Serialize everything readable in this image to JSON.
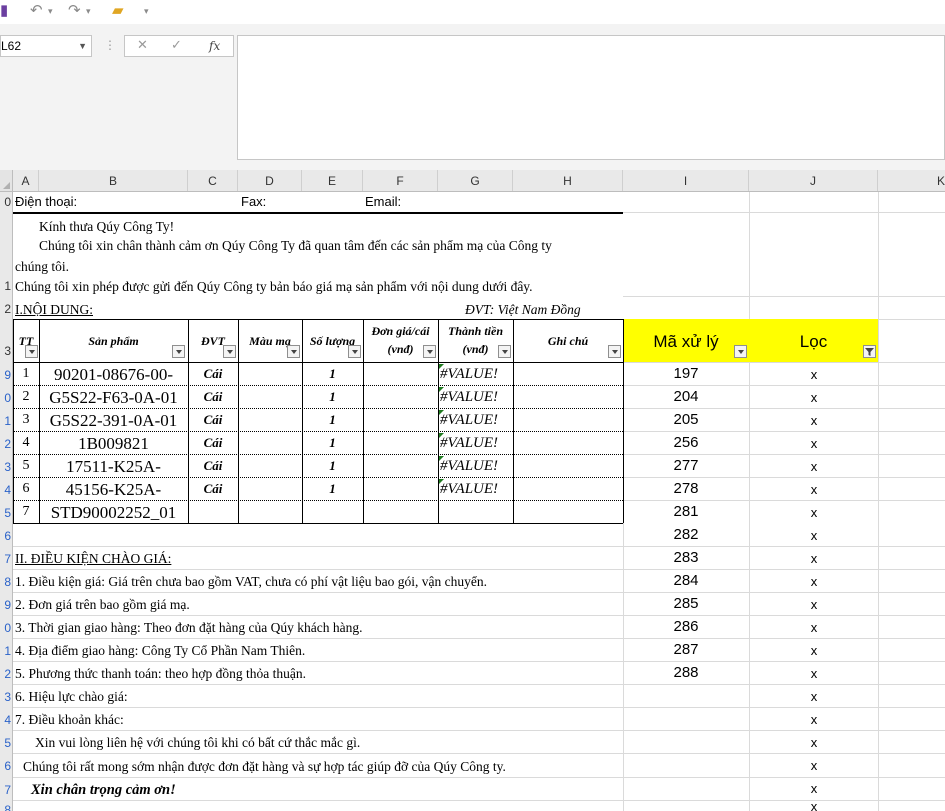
{
  "toolbar": {
    "icons": [
      "save-icon",
      "undo-icon",
      "redo-icon",
      "open-folder-icon"
    ]
  },
  "formula_bar": {
    "name_box": "L62",
    "cancel": "✕",
    "enter": "✓",
    "fx": "fx",
    "content": ""
  },
  "columns": [
    "A",
    "B",
    "C",
    "D",
    "E",
    "F",
    "G",
    "H",
    "I",
    "J",
    "K"
  ],
  "row_numbers": [
    "0",
    "1",
    "2",
    "3",
    "9",
    "0",
    "1",
    "2",
    "3",
    "4",
    "5",
    "6",
    "7",
    "8",
    "9",
    "0",
    "1",
    "2",
    "3",
    "4",
    "5",
    "6",
    "7",
    "8"
  ],
  "header_info": {
    "phone_label": "Điện thoại:",
    "fax_label": "Fax:",
    "email_label": "Email:"
  },
  "greeting": {
    "line1": "Kính thưa Qúy Công Ty!",
    "line2": "Chúng tôi xin chân thành cảm ơn Qúy Công Ty đã quan tâm đến các sản phẩm mạ của Công ty",
    "line3": "chúng tôi.",
    "line4": "Chúng tôi xin phép được gửi đến Qúy Công ty bản báo giá mạ sản phẩm với nội dung dưới đây."
  },
  "section1": {
    "title": "I.NỘI DUNG:",
    "currency": "ĐVT: Việt Nam Đồng"
  },
  "table": {
    "headers": {
      "tt": "TT",
      "product": "Sản phẩm",
      "unit": "ĐVT",
      "finish": "Màu mạ",
      "qty": "Số lượng",
      "price": "Đơn giá/cái",
      "price_unit": "(vnđ)",
      "total": "Thành tiền",
      "total_unit": "(vnđ)",
      "note": "Ghi chú",
      "code": "Mã xử lý",
      "filter": "Lọc"
    },
    "rows": [
      {
        "tt": "1",
        "product": "90201-08676-00-",
        "unit": "Cái",
        "qty": "1",
        "total": "#VALUE!"
      },
      {
        "tt": "2",
        "product": "G5S22-F63-0A-01",
        "unit": "Cái",
        "qty": "1",
        "total": "#VALUE!"
      },
      {
        "tt": "3",
        "product": "G5S22-391-0A-01",
        "unit": "Cái",
        "qty": "1",
        "total": "#VALUE!"
      },
      {
        "tt": "4",
        "product": "1B009821",
        "unit": "Cái",
        "qty": "1",
        "total": "#VALUE!"
      },
      {
        "tt": "5",
        "product": "17511-K25A-",
        "unit": "Cái",
        "qty": "1",
        "total": "#VALUE!"
      },
      {
        "tt": "6",
        "product": "45156-K25A-",
        "unit": "Cái",
        "qty": "1",
        "total": "#VALUE!"
      },
      {
        "tt": "7",
        "product": "STD90002252_01",
        "unit": "",
        "qty": "",
        "total": ""
      }
    ]
  },
  "codes": [
    "197",
    "204",
    "205",
    "256",
    "277",
    "278",
    "281",
    "282",
    "283",
    "284",
    "285",
    "286",
    "287",
    "288"
  ],
  "filter_marks": [
    "x",
    "x",
    "x",
    "x",
    "x",
    "x",
    "x",
    "x",
    "x",
    "x",
    "x",
    "x",
    "x",
    "x",
    "x",
    "x",
    "x",
    "x",
    "x",
    "x"
  ],
  "section2": {
    "title": "II. ĐIỀU KIỆN CHÀO GIÁ:",
    "items": [
      "1. Điều kiện giá: Giá trên chưa bao gồm VAT, chưa có phí vật liệu bao gói, vận chuyển.",
      "2. Đơn giá trên bao gồm giá mạ.",
      "3. Thời gian giao hàng: Theo đơn đặt hàng của Qúy khách hàng.",
      "4. Địa điểm giao hàng: Công Ty Cổ Phần Nam Thiên.",
      "5. Phương thức thanh toán: theo hợp đồng thỏa thuận.",
      "6. Hiệu lực chào giá:",
      "7. Điều khoản khác:"
    ],
    "contact": "Xin vui lòng liên hệ với chúng tôi khi có bất cứ thắc mắc gì.",
    "hope": "Chúng tôi rất mong sớm nhận được đơn đặt hàng và sự hợp tác giúp đỡ của Qúy Công ty.",
    "thanks": "Xin chân trọng cảm ơn!"
  },
  "colors": {
    "highlight": "#ffff00",
    "row_number": "#2a62c9",
    "error_triangle": "#1f7a1f"
  }
}
